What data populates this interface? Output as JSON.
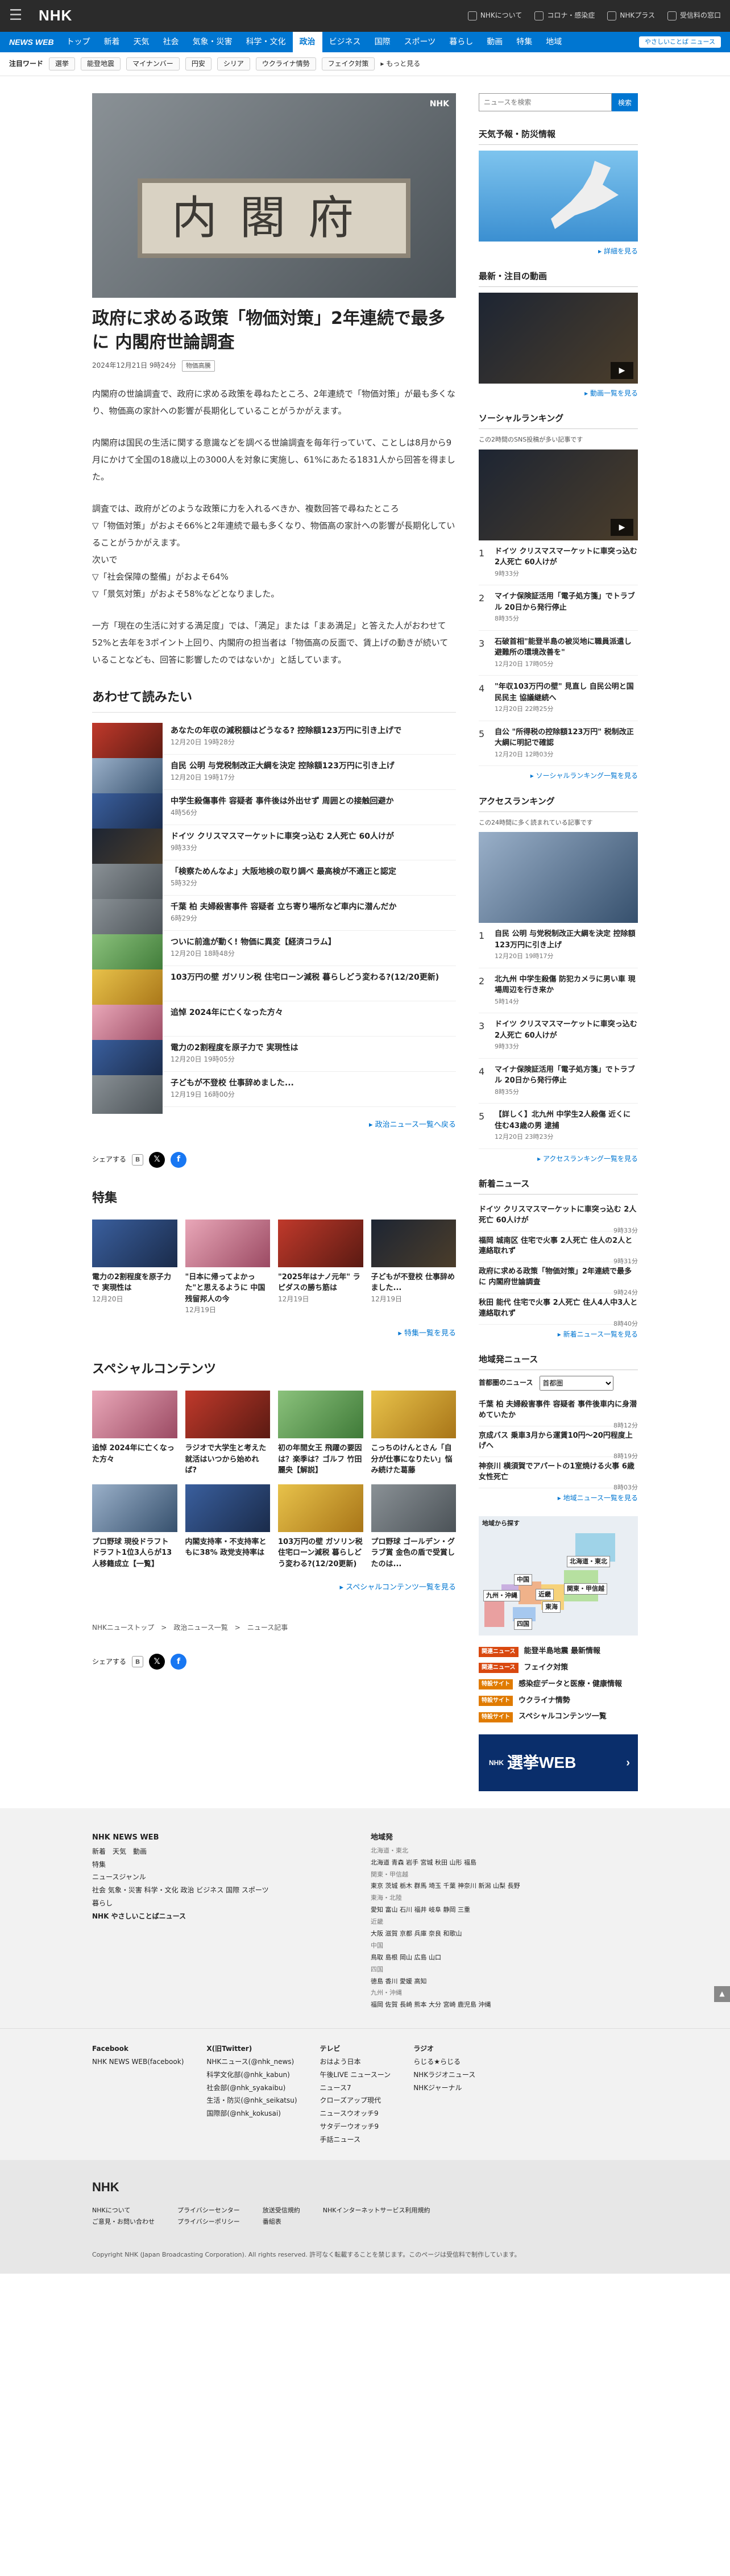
{
  "topbar": {
    "logo": "NHK",
    "links": [
      "NHKについて",
      "コロナ・感染症",
      "NHKプラス",
      "受信料の窓口"
    ]
  },
  "nav": {
    "brand": "NEWS WEB",
    "items": [
      "トップ",
      "新着",
      "天気",
      "社会",
      "気象・災害",
      "科学・文化",
      "政治",
      "ビジネス",
      "国際",
      "スポーツ",
      "暮らし",
      "動画",
      "特集",
      "地域"
    ],
    "active_index": 6,
    "easy_label": "やさしいことば ニュース"
  },
  "keywords": {
    "label": "注目ワード",
    "tags": [
      "選挙",
      "能登地震",
      "マイナンバー",
      "円安",
      "シリア",
      "ウクライナ情勢",
      "フェイク対策"
    ],
    "more": "もっと見る"
  },
  "article": {
    "title": "政府に求める政策「物価対策」2年連続で最多に 内閣府世論調査",
    "date": "2024年12月21日 9時24分",
    "tag": "物価高騰",
    "paragraphs": [
      "内閣府の世論調査で、政府に求める政策を尋ねたところ、2年連続で「物価対策」が最も多くなり、物価高の家計への影響が長期化していることがうかがえます。",
      "内閣府は国民の生活に関する意識などを調べる世論調査を毎年行っていて、ことしは8月から9月にかけて全国の18歳以上の3000人を対象に実施し、61%にあたる1831人から回答を得ました。",
      "調査では、政府がどのような政策に力を入れるべきか、複数回答で尋ねたところ\n▽「物価対策」がおよそ66%と2年連続で最も多くなり、物価高の家計への影響が長期化していることがうかがえます。\n次いで\n▽「社会保障の整備」がおよそ64%\n▽「景気対策」がおよそ58%などとなりました。",
      "一方「現在の生活に対する満足度」では、「満足」または「まあ満足」と答えた人がおわせて52%と去年を3ポイント上回り、内閣府の担当者は「物価高の反面で、賃上げの動きが続いていることなども、回答に影響したのではないか」と話しています。"
    ]
  },
  "related": {
    "heading": "あわせて読みたい",
    "items": [
      {
        "title": "あなたの年収の減税額はどうなる? 控除額123万円に引き上げで",
        "date": "12月20日 19時28分"
      },
      {
        "title": "自民 公明 与党税制改正大綱を決定 控除額123万円に引き上げ",
        "date": "12月20日 19時17分"
      },
      {
        "title": "中学生殺傷事件 容疑者 事件後は外出せず 周囲との接触回避か",
        "date": "4時56分"
      },
      {
        "title": "ドイツ クリスマスマーケットに車突っ込む 2人死亡 60人けが",
        "date": "9時33分"
      },
      {
        "title": "「検察ためんなよ」大阪地検の取り調べ 最高検が不適正と認定",
        "date": "5時32分"
      },
      {
        "title": "千葉 柏 夫婦殺害事件 容疑者 立ち寄り場所など車内に潜んだか",
        "date": "6時29分"
      },
      {
        "title": "ついに前進が動く! 物価に異変【経済コラム】",
        "date": "12月20日 18時48分"
      },
      {
        "title": "103万円の壁 ガソリン税 住宅ローン減税 暮らしどう変わる?(12/20更新)",
        "date": ""
      },
      {
        "title": "追悼 2024年に亡くなった方々",
        "date": ""
      },
      {
        "title": "電力の2割程度を原子力で 実現性は",
        "date": "12月20日 19時05分"
      },
      {
        "title": "子どもが不登校 仕事辞めました...",
        "date": "12月19日 16時00分"
      }
    ],
    "more": "政治ニュース一覧へ戻る"
  },
  "share": {
    "label": "シェアする"
  },
  "features": {
    "heading": "特集",
    "items": [
      {
        "title": "電力の2割程度を原子力で 実現性は",
        "date": "12月20日"
      },
      {
        "title": "\"日本に帰ってよかった\"と思えるように 中国残留邦人の今",
        "date": "12月19日"
      },
      {
        "title": "\"2025年はナノ元年\" ラピダスの勝ち筋は",
        "date": "12月19日"
      },
      {
        "title": "子どもが不登校 仕事辞めました...",
        "date": "12月19日"
      }
    ],
    "more": "特集一覧を見る"
  },
  "special": {
    "heading": "スペシャルコンテンツ",
    "items": [
      {
        "title": "追悼 2024年に亡くなった方々"
      },
      {
        "title": "ラジオで大学生と考えた 就活はいつから始めれば?"
      },
      {
        "title": "初の年間女王 飛躍の要因は？楽季は？ゴルフ 竹田麗央【解説】"
      },
      {
        "title": "こっちのけんとさん「自分が仕事になりたい」悩み続けた葛藤"
      },
      {
        "title": "プロ野球 現役ドラフト ドラフト1位3人らが13人移籍成立【一覧】"
      },
      {
        "title": "内閣支持率・不支持率ともに38% 政党支持率は"
      },
      {
        "title": "103万円の壁 ガソリン税 住宅ローン減税 暮らしどう変わる?(12/20更新)"
      },
      {
        "title": "プロ野球 ゴールデン・グラブ賞 金色の盾で受賞したのは..."
      }
    ],
    "more": "スペシャルコンテンツ一覧を見る"
  },
  "breadcrumb": [
    "NHKニューストップ",
    "政治ニュース一覧",
    "ニュース記事"
  ],
  "sidebar": {
    "search_placeholder": "ニュースを検索",
    "search_button": "検索",
    "weather": {
      "heading": "天気予報・防災情報",
      "more": "詳細を見る"
    },
    "video": {
      "heading": "最新・注目の動画",
      "more": "動画一覧を見る"
    },
    "social": {
      "heading": "ソーシャルランキング",
      "sub": "この2時間のSNS投稿が多い記事です",
      "items": [
        {
          "title": "ドイツ クリスマスマーケットに車突っ込む 2人死亡 60人けが",
          "time": "9時33分"
        },
        {
          "title": "マイナ保険証活用「電子処方箋」でトラブル 20日から発行停止",
          "time": "8時35分"
        },
        {
          "title": "石破首相\"能登半島の被災地に職員派遣し避難所の環境改善を\"",
          "time": "12月20日 17時05分"
        },
        {
          "title": "\"年収103万円の壁\" 見直し 自民公明と国民民主 協議継続へ",
          "time": "12月20日 22時25分"
        },
        {
          "title": "自公 \"所得税の控除額123万円\" 税制改正大綱に明記で確認",
          "time": "12月20日 12時03分"
        }
      ],
      "more": "ソーシャルランキング一覧を見る"
    },
    "access": {
      "heading": "アクセスランキング",
      "sub": "この24時間に多く読まれている記事です",
      "items": [
        {
          "title": "自民 公明 与党税制改正大綱を決定 控除額123万円に引き上げ",
          "time": "12月20日 19時17分"
        },
        {
          "title": "北九州 中学生殺傷 防犯カメラに男い車 現場周辺を行き来か",
          "time": "5時14分"
        },
        {
          "title": "ドイツ クリスマスマーケットに車突っ込む 2人死亡 60人けが",
          "time": "9時33分"
        },
        {
          "title": "マイナ保険証活用「電子処方箋」でトラブル 20日から発行停止",
          "time": "8時35分"
        },
        {
          "title": "【詳しく】北九州 中学生2人殺傷 近くに住む43歳の男 逮捕",
          "time": "12月20日 23時23分"
        }
      ],
      "more": "アクセスランキング一覧を見る"
    },
    "latest": {
      "heading": "新着ニュース",
      "items": [
        {
          "title": "ドイツ クリスマスマーケットに車突っ込む 2人死亡 60人けが",
          "time": "9時33分"
        },
        {
          "title": "福岡 城南区 住宅で火事 2人死亡 住人の2人と連絡取れず",
          "time": "9時31分"
        },
        {
          "title": "政府に求める政策「物価対策」2年連続で最多に 内閣府世論調査",
          "time": "9時24分"
        },
        {
          "title": "秋田 能代 住宅で火事 2人死亡 住人4人中3人と連絡取れず",
          "time": "8時40分"
        }
      ],
      "more": "新着ニュース一覧を見る"
    },
    "local": {
      "heading": "地域発ニュース",
      "area_label": "首都圏のニュース",
      "area_value": "首都圏",
      "items": [
        {
          "title": "千葉 柏 夫婦殺害事件 容疑者 事件後車内に身潜めていたか",
          "time": "8時12分"
        },
        {
          "title": "京成バス 乗車3月から運賃10円〜20円程度上げへ",
          "time": "8時19分"
        },
        {
          "title": "神奈川 横須賀でアパートの1室焼ける火事 6歳女性死亡",
          "time": "8時03分"
        }
      ],
      "more": "地域ニュース一覧を見る",
      "map_caption": "地域から探す",
      "regions": [
        "北海道・東北",
        "関東・甲信越",
        "中国",
        "九州・沖縄",
        "東海",
        "近畿",
        "四国"
      ]
    },
    "tags": [
      {
        "badge": "関連ニュース",
        "text": "能登半島地震 最新情報",
        "color": "#d9480f"
      },
      {
        "badge": "関連ニュース",
        "text": "フェイク対策",
        "color": "#d9480f"
      },
      {
        "badge": "特設サイト",
        "text": "感染症データと医療・健康情報",
        "color": "#e07b00"
      },
      {
        "badge": "特設サイト",
        "text": "ウクライナ情勢",
        "color": "#e07b00"
      },
      {
        "badge": "特設サイト",
        "text": "スペシャルコンテンツ一覧",
        "color": "#e07b00"
      }
    ],
    "election": {
      "pre": "NHK",
      "label": "選挙WEB"
    }
  },
  "footer": {
    "cols": [
      {
        "title": "NHK NEWS WEB",
        "lines": [
          "新着　天気　動画",
          "特集",
          "ニュースジャンル",
          "社会 気象・災害 科学・文化 政治 ビジネス 国際 スポーツ",
          "暮らし",
          "NHK やさしいことばニュース"
        ]
      },
      {
        "title": "地域発",
        "lines": [
          "北海道・東北",
          "北海道 青森 岩手 宮城 秋田 山形 福島",
          "関東・甲信越",
          "東京 茨城 栃木 群馬 埼玉 千葉 神奈川 新潟 山梨 長野",
          "東海・北陸",
          "愛知 富山 石川 福井 岐阜 静岡 三重",
          "近畿",
          "大阪 滋賀 京都 兵庫 奈良 和歌山",
          "中国",
          "鳥取 島根 岡山 広島 山口",
          "四国",
          "徳島 香川 愛媛 高知",
          "九州・沖縄",
          "福岡 佐賀 長崎 熊本 大分 宮崎 鹿児島 沖縄"
        ]
      }
    ],
    "sns": [
      {
        "title": "Facebook",
        "lines": [
          "NHK NEWS WEB(facebook)",
          "X(旧Twitter)"
        ]
      },
      {
        "title": "X(旧Twitter)",
        "lines": [
          "NHKニュース(@nhk_news)",
          "科学文化部(@nhk_kabun)",
          "社会部(@nhk_syakaibu)",
          "生活・防災(@nhk_seikatsu)",
          "国際部(@nhk_kokusai)"
        ]
      },
      {
        "title": "テレビ",
        "lines": [
          "おはよう日本",
          "午後LIVE ニュースーン",
          "ニュース7",
          "クローズアップ現代",
          "ニュースウオッチ9",
          "サタデーウオッチ9",
          "手話ニュース"
        ]
      },
      {
        "title": "ラジオ",
        "lines": [
          "らじる★らじる",
          "NHKラジオニュース",
          "NHKジャーナル"
        ]
      }
    ],
    "bottom_links": [
      "NHKについて",
      "ご意見・お問い合わせ",
      "プライバシーセンター",
      "プライバシーポリシー",
      "放送受信規約",
      "番組表",
      "NHKインターネットサービス利用規約"
    ],
    "copyright": "Copyright NHK (Japan Broadcasting Corporation). All rights reserved. 許可なく転載することを禁じます。このページは受信料で制作しています。",
    "totop": "▲"
  }
}
